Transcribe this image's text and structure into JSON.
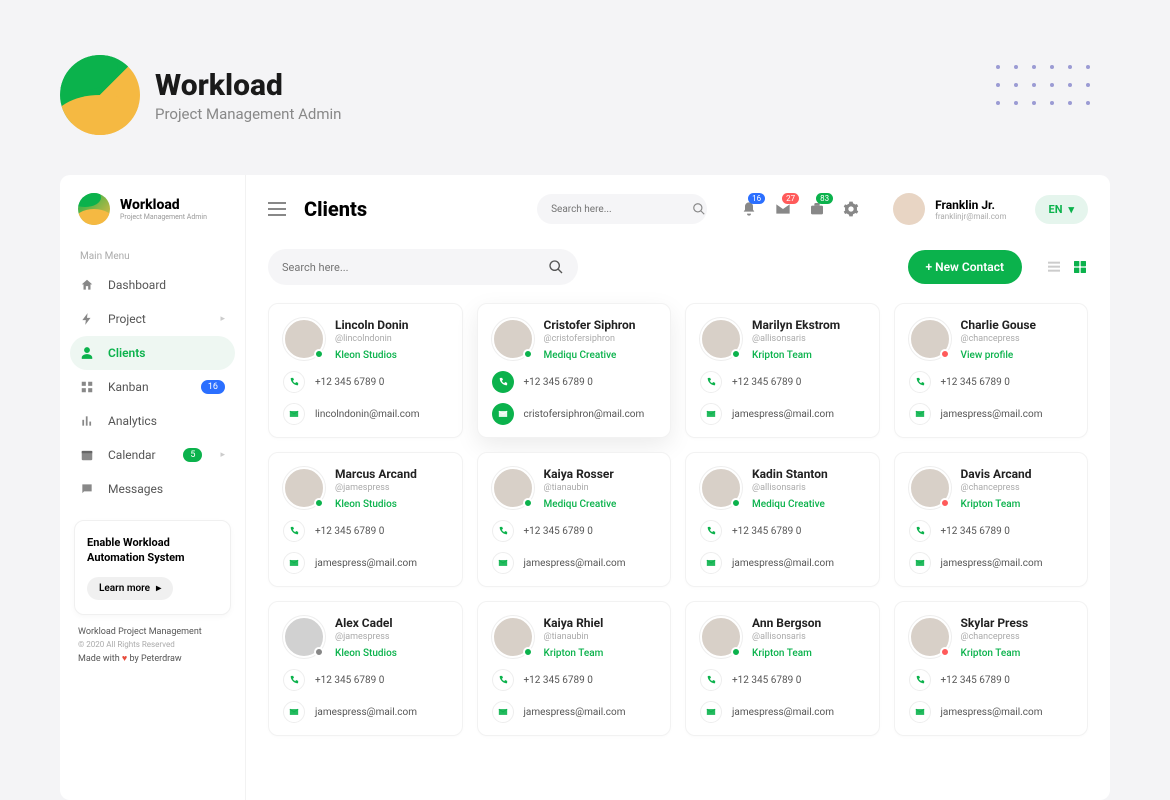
{
  "brand": {
    "title": "Workload",
    "subtitle": "Project Management Admin"
  },
  "sidebar": {
    "section": "Main Menu",
    "items": [
      {
        "label": "Dashboard"
      },
      {
        "label": "Project"
      },
      {
        "label": "Clients"
      },
      {
        "label": "Kanban",
        "badge": "16"
      },
      {
        "label": "Analytics"
      },
      {
        "label": "Calendar",
        "badge": "5"
      },
      {
        "label": "Messages"
      }
    ],
    "card_title": "Enable Workload Automation System",
    "learn_more": "Learn more",
    "footer1": "Workload Project Management",
    "footer2": "© 2020 All Rights Reserved",
    "footer3a": "Made with ",
    "footer3b": " by Peterdraw"
  },
  "header": {
    "page_title": "Clients",
    "search_placeholder": "Search here...",
    "badges": {
      "bell": "16",
      "mail": "27",
      "gift": "83"
    },
    "user": {
      "name": "Franklin Jr.",
      "email": "franklinjr@mail.com"
    },
    "lang": "EN"
  },
  "toolbar": {
    "search_placeholder": "Search here...",
    "new_contact": "+ New Contact"
  },
  "clients": [
    {
      "name": "Lincoln Donin",
      "handle": "@lincolndonin",
      "company": "Kleon Studios",
      "phone": "+12 345 6789 0",
      "email": "lincolndonin@mail.com",
      "status": "online",
      "highlight": false
    },
    {
      "name": "Cristofer Siphron",
      "handle": "@cristofersiphron",
      "company": "Mediqu Creative",
      "phone": "+12 345 6789 0",
      "email": "cristofersiphron@mail.com",
      "status": "online",
      "highlight": true
    },
    {
      "name": "Marilyn Ekstrom",
      "handle": "@allisonsaris",
      "company": "Kripton Team",
      "phone": "+12 345 6789 0",
      "email": "jamespress@mail.com",
      "status": "online",
      "highlight": false
    },
    {
      "name": "Charlie Gouse",
      "handle": "@chancepress",
      "company": "View profile",
      "phone": "+12 345 6789 0",
      "email": "jamespress@mail.com",
      "status": "busy",
      "highlight": false
    },
    {
      "name": "Marcus  Arcand",
      "handle": "@jamespress",
      "company": "Kleon Studios",
      "phone": "+12 345 6789 0",
      "email": "jamespress@mail.com",
      "status": "online",
      "highlight": false
    },
    {
      "name": "Kaiya Rosser",
      "handle": "@tianaubin",
      "company": "Mediqu Creative",
      "phone": "+12 345 6789 0",
      "email": "jamespress@mail.com",
      "status": "online",
      "highlight": false
    },
    {
      "name": "Kadin Stanton",
      "handle": "@allisonsaris",
      "company": "Mediqu Creative",
      "phone": "+12 345 6789 0",
      "email": "jamespress@mail.com",
      "status": "online",
      "highlight": false
    },
    {
      "name": "Davis Arcand",
      "handle": "@chancepress",
      "company": "Kripton Team",
      "phone": "+12 345 6789 0",
      "email": "jamespress@mail.com",
      "status": "busy",
      "highlight": false
    },
    {
      "name": "Alex Cadel",
      "handle": "@jamespress",
      "company": "Kleon Studios",
      "phone": "+12 345 6789 0",
      "email": "jamespress@mail.com",
      "status": "online",
      "highlight": false,
      "bw": true
    },
    {
      "name": "Kaiya Rhiel",
      "handle": "@tianaubin",
      "company": "Kripton Team",
      "phone": "+12 345 6789 0",
      "email": "jamespress@mail.com",
      "status": "online",
      "highlight": false
    },
    {
      "name": "Ann Bergson",
      "handle": "@allisonsaris",
      "company": "Kripton Team",
      "phone": "+12 345 6789 0",
      "email": "jamespress@mail.com",
      "status": "online",
      "highlight": false
    },
    {
      "name": "Skylar Press",
      "handle": "@chancepress",
      "company": "Kripton Team",
      "phone": "+12 345 6789 0",
      "email": "jamespress@mail.com",
      "status": "busy",
      "highlight": false
    }
  ]
}
